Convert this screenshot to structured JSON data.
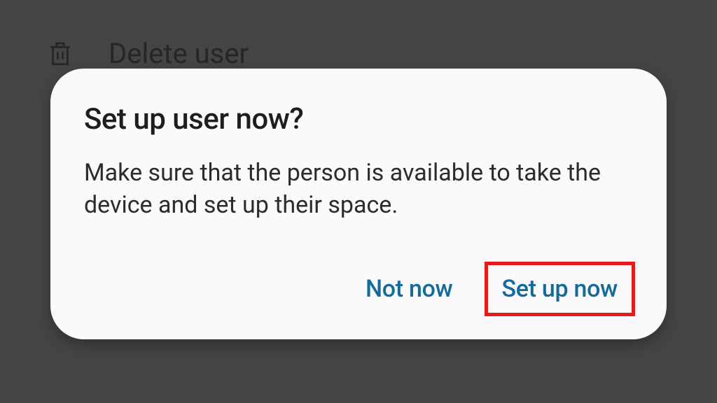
{
  "background": {
    "delete_label": "Delete user",
    "icon_name": "trash-icon"
  },
  "dialog": {
    "title": "Set up user now?",
    "body": "Make sure that the person is available to take the device and set up their space.",
    "actions": {
      "negative": "Not now",
      "positive": "Set up now"
    }
  },
  "colors": {
    "accent": "#156a9c",
    "highlight_border": "#e41b17",
    "dialog_bg": "#faf9fb",
    "scrim": "rgba(50,50,50,0.55)"
  }
}
